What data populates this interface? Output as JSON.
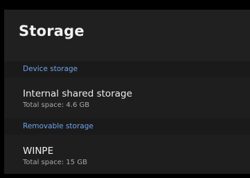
{
  "header": {
    "title": "Storage"
  },
  "sections": [
    {
      "header": "Device storage",
      "items": [
        {
          "name": "Internal shared storage",
          "detail": "Total space: 4.6 GB"
        }
      ]
    },
    {
      "header": "Removable storage",
      "items": [
        {
          "name": "WINPE",
          "detail": "Total space: 15 GB"
        }
      ]
    }
  ],
  "colors": {
    "accent": "#6fa3e8",
    "background": "#1c1c1c",
    "title_text": "#f2f2f2"
  }
}
